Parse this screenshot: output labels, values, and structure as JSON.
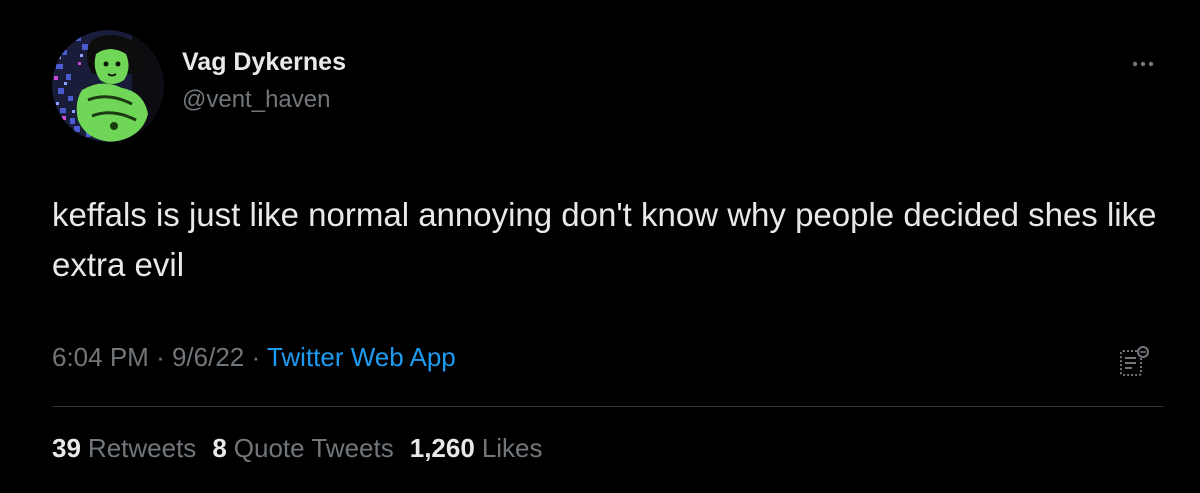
{
  "tweet": {
    "display_name": "Vag Dykernes",
    "handle": "@vent_haven",
    "text": "keffals is just like normal annoying don't know why people decided shes like extra evil",
    "time": "6:04 PM",
    "separator1": "·",
    "date": "9/6/22",
    "separator2": "·",
    "source": "Twitter Web App",
    "more_icon": "more-dots-icon",
    "analytics_icon": "analytics-icon"
  },
  "stats": {
    "retweets_count": "39",
    "retweets_label": "Retweets",
    "quotes_count": "8",
    "quotes_label": "Quote Tweets",
    "likes_count": "1,260",
    "likes_label": "Likes"
  },
  "colors": {
    "background": "#000000",
    "primary_text": "#e7e9ea",
    "secondary_text": "#71767b",
    "link": "#1d9bf0",
    "divider": "#2f3336"
  }
}
